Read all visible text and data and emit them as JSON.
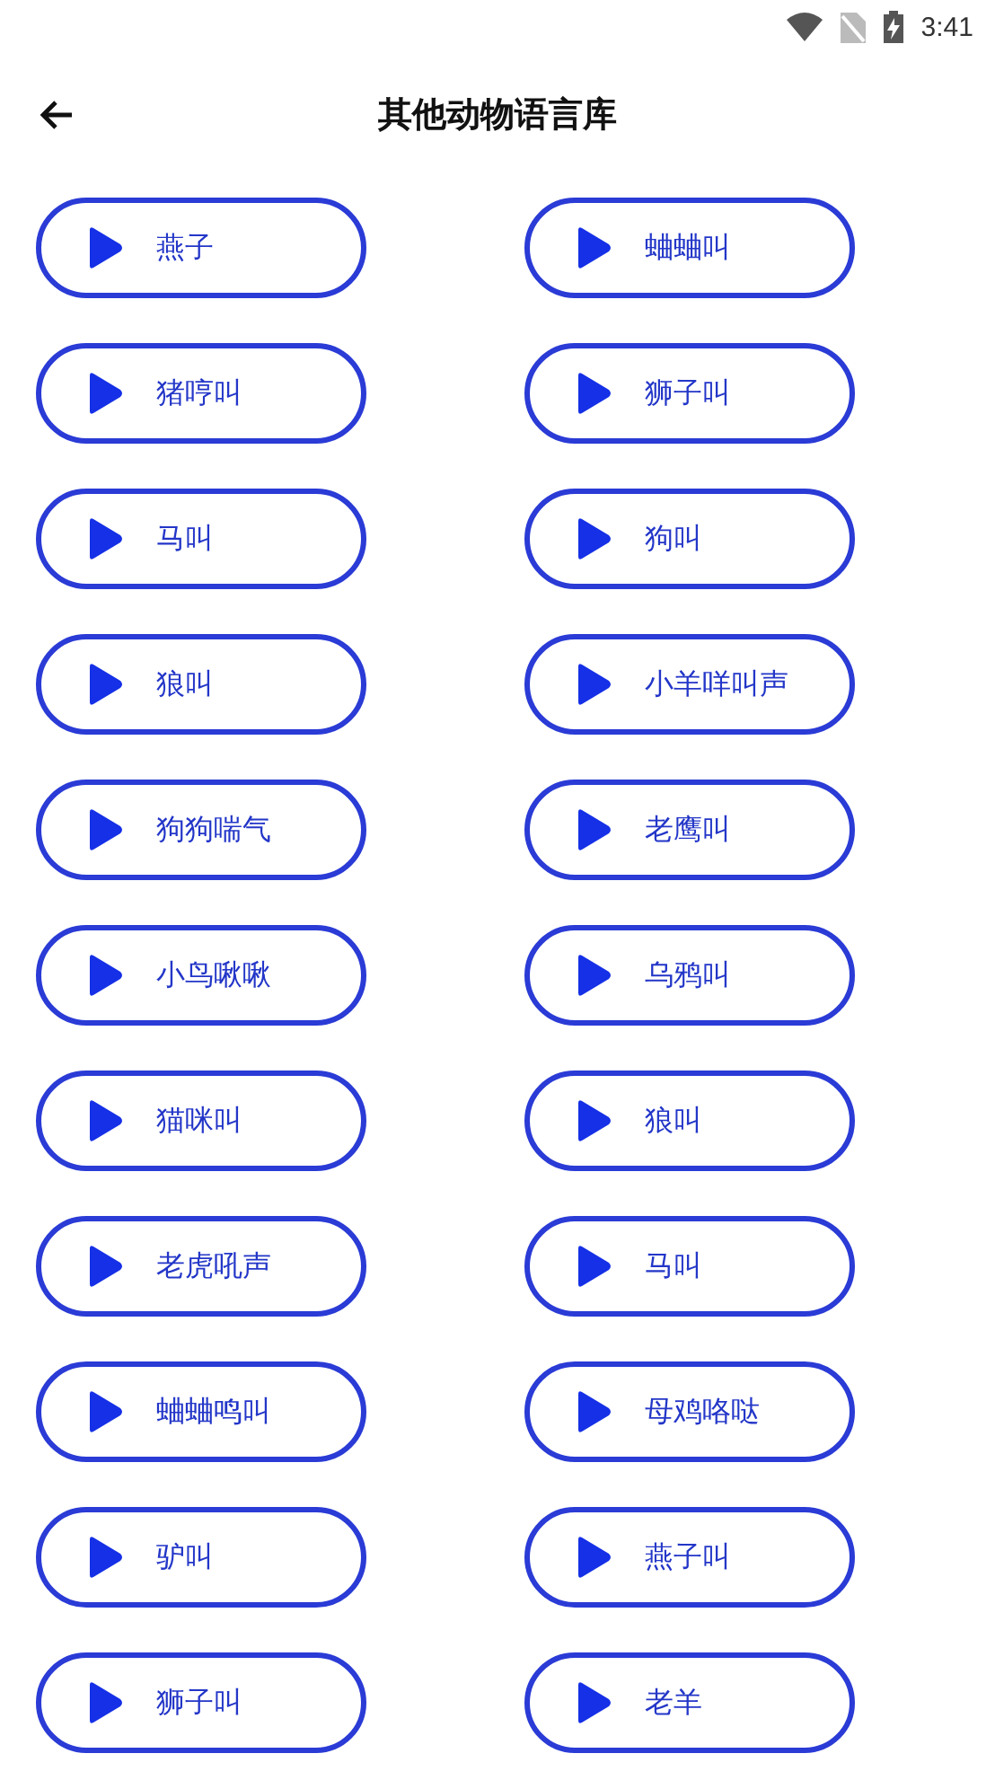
{
  "status_bar": {
    "time": "3:41"
  },
  "header": {
    "title": "其他动物语言库"
  },
  "sounds": [
    {
      "label": "燕子"
    },
    {
      "label": "蛐蛐叫"
    },
    {
      "label": "猪哼叫"
    },
    {
      "label": "狮子叫"
    },
    {
      "label": "马叫"
    },
    {
      "label": "狗叫"
    },
    {
      "label": "狼叫"
    },
    {
      "label": "小羊咩叫声"
    },
    {
      "label": "狗狗喘气"
    },
    {
      "label": "老鹰叫"
    },
    {
      "label": "小鸟啾啾"
    },
    {
      "label": "乌鸦叫"
    },
    {
      "label": "猫咪叫"
    },
    {
      "label": "狼叫"
    },
    {
      "label": "老虎吼声"
    },
    {
      "label": "马叫"
    },
    {
      "label": "蛐蛐鸣叫"
    },
    {
      "label": "母鸡咯哒"
    },
    {
      "label": "驴叫"
    },
    {
      "label": "燕子叫"
    },
    {
      "label": "狮子叫"
    },
    {
      "label": "老羊"
    }
  ]
}
